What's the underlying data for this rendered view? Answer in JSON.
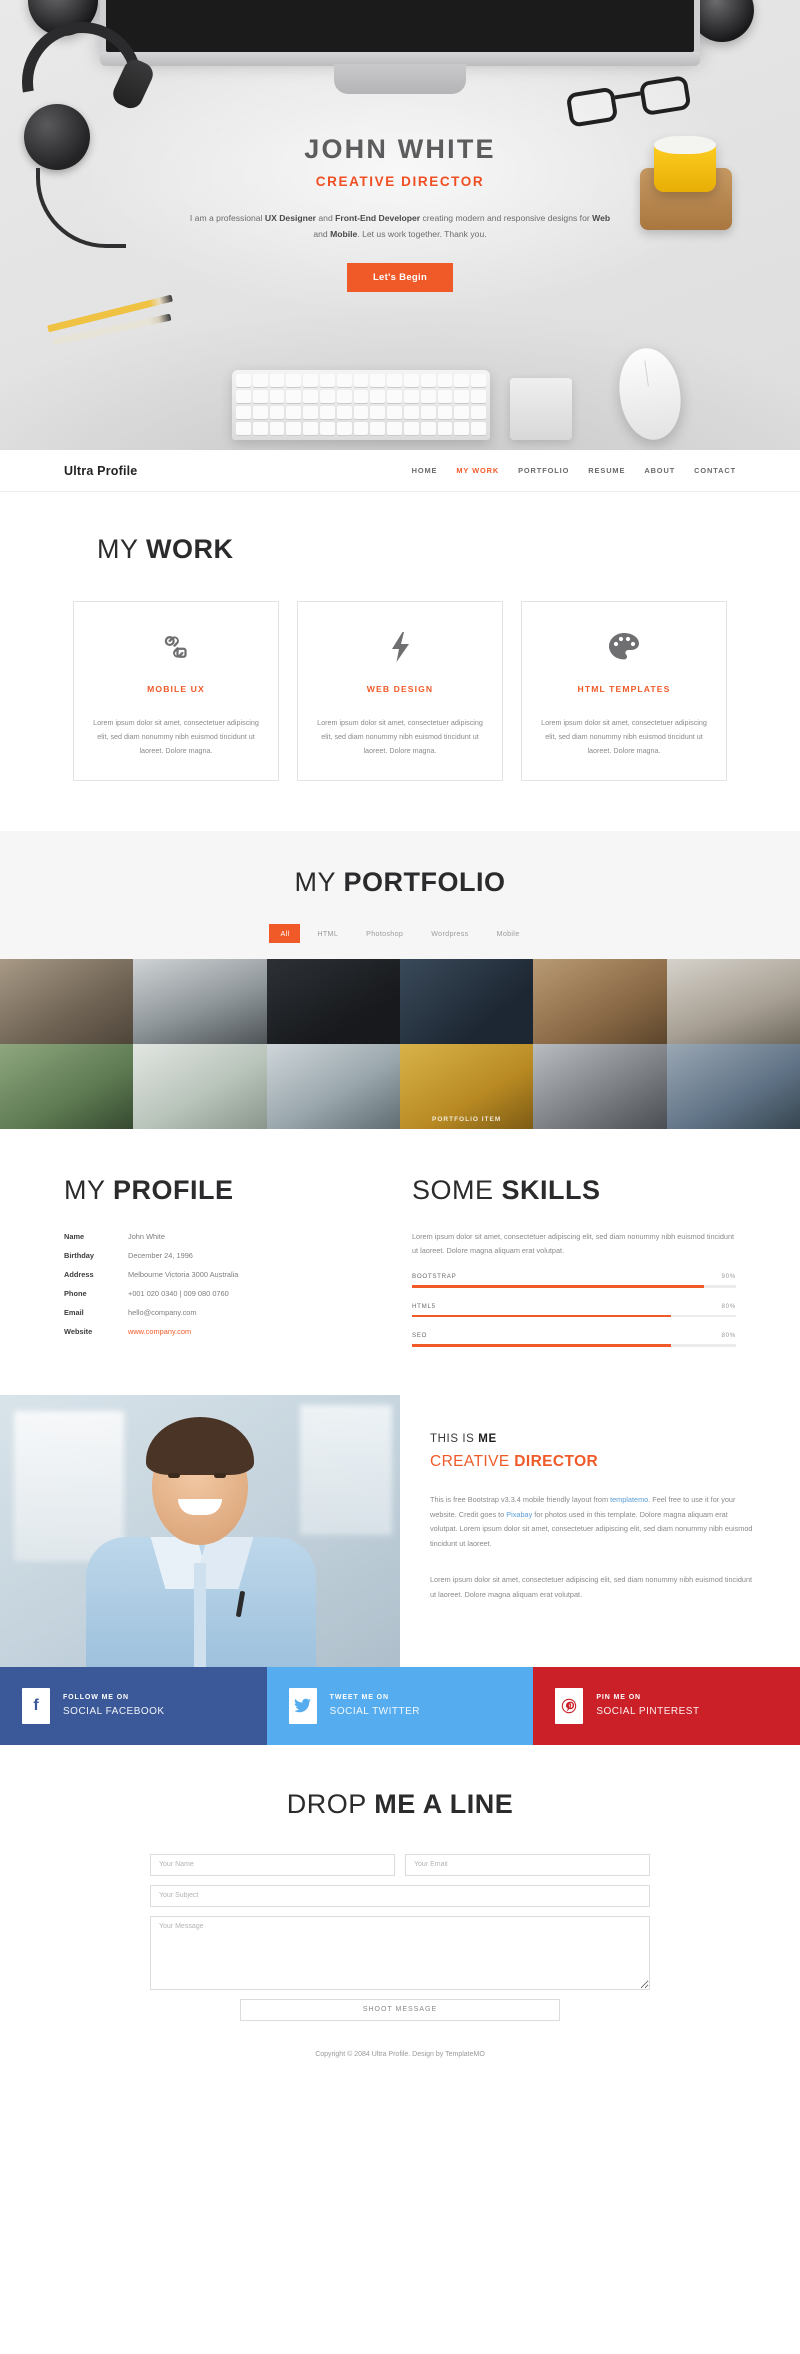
{
  "hero": {
    "name": "JOHN WHITE",
    "role": "CREATIVE DIRECTOR",
    "desc_1": "I am a professional ",
    "desc_b1": "UX Designer",
    "desc_2": " and ",
    "desc_b2": "Front-End Developer",
    "desc_3": " creating modern and responsive designs for ",
    "desc_b3": "Web",
    "desc_4": " and ",
    "desc_b4": "Mobile",
    "desc_5": ". Let us work together. Thank you.",
    "cta": "Let's Begin"
  },
  "nav": {
    "brand": "Ultra Profile",
    "items": [
      {
        "label": "HOME",
        "active": false
      },
      {
        "label": "MY WORK",
        "active": true
      },
      {
        "label": "PORTFOLIO",
        "active": false
      },
      {
        "label": "RESUME",
        "active": false
      },
      {
        "label": "ABOUT",
        "active": false
      },
      {
        "label": "CONTACT",
        "active": false
      }
    ]
  },
  "work": {
    "title_light": "MY ",
    "title_bold": "WORK",
    "cards": [
      {
        "icon": "chain-link-icon",
        "title": "MOBILE UX",
        "text": "Lorem ipsum dolor sit amet, consectetuer adipiscing elit, sed diam nonummy nibh euismod tincidunt ut laoreet. Dolore magna."
      },
      {
        "icon": "lightning-bolt-icon",
        "title": "WEB DESIGN",
        "text": "Lorem ipsum dolor sit amet, consectetuer adipiscing elit, sed diam nonummy nibh euismod tincidunt ut laoreet. Dolore magna."
      },
      {
        "icon": "palette-icon",
        "title": "HTML TEMPLATES",
        "text": "Lorem ipsum dolor sit amet, consectetuer adipiscing elit, sed diam nonummy nibh euismod tincidunt ut laoreet. Dolore magna."
      }
    ]
  },
  "portfolio": {
    "title_light": "MY ",
    "title_bold": "PORTFOLIO",
    "filters": [
      {
        "label": "All",
        "active": true
      },
      {
        "label": "HTML",
        "active": false
      },
      {
        "label": "Photoshop",
        "active": false
      },
      {
        "label": "Wordpress",
        "active": false
      },
      {
        "label": "Mobile",
        "active": false
      }
    ],
    "tiles": [
      {
        "caption": ""
      },
      {
        "caption": ""
      },
      {
        "caption": ""
      },
      {
        "caption": ""
      },
      {
        "caption": ""
      },
      {
        "caption": ""
      },
      {
        "caption": ""
      },
      {
        "caption": ""
      },
      {
        "caption": ""
      },
      {
        "caption": "PORTFOLIO ITEM"
      },
      {
        "caption": ""
      },
      {
        "caption": ""
      }
    ]
  },
  "profile": {
    "title_light": "MY ",
    "title_bold": "PROFILE",
    "rows": [
      {
        "key": "Name",
        "value": "John White",
        "link": false
      },
      {
        "key": "Birthday",
        "value": "December 24, 1996",
        "link": false
      },
      {
        "key": "Address",
        "value": "Melbourne Victoria 3000 Australia",
        "link": false
      },
      {
        "key": "Phone",
        "value": "+001 020 0340 | 009 080 0760",
        "link": false
      },
      {
        "key": "Email",
        "value": "hello@company.com",
        "link": false
      },
      {
        "key": "Website",
        "value": "www.company.com",
        "link": true
      }
    ]
  },
  "skills": {
    "title_light": "SOME ",
    "title_bold": "SKILLS",
    "intro": "Lorem ipsum dolor sit amet, consectetuer adipiscing elit, sed diam nonummy nibh euismod tincidunt ut laoreet. Dolore magna aliquam erat volutpat.",
    "items": [
      {
        "label": "BOOTSTRAP",
        "pct": "90%",
        "value": 90
      },
      {
        "label": "HTML5",
        "pct": "80%",
        "value": 80
      },
      {
        "label": "SEO",
        "pct": "80%",
        "value": 80
      }
    ]
  },
  "about": {
    "kicker_light": "THIS IS ",
    "kicker_bold": "ME",
    "role_light": "CREATIVE ",
    "role_bold": "DIRECTOR",
    "p1_a": "This is free Bootstrap v3.3.4 mobile friendly layout from ",
    "p1_link1": "templatemo",
    "p1_b": ". Feel free to use it for your website. Credit goes to ",
    "p1_link2": "Pixabay",
    "p1_c": " for photos used in this template. Dolore magna aliquam erat volutpat. Lorem ipsum dolor sit amet, consectetuer adipiscing elit, sed diam nonummy nibh euismod tincidunt ut laoreet.",
    "p2": "Lorem ipsum dolor sit amet, consectetuer adipiscing elit, sed diam nonummy nibh euismod tincidunt ut laoreet. Dolore magna aliquam erat volutpat."
  },
  "social": [
    {
      "icon": "facebook-icon",
      "top": "FOLLOW ME ON",
      "bottom": "SOCIAL FACEBOOK",
      "bg": "#3b5998",
      "glyph": "f",
      "glyph_color": "#3b5998"
    },
    {
      "icon": "twitter-icon",
      "top": "TWEET ME ON",
      "bottom": "SOCIAL TWITTER",
      "bg": "#55acee",
      "glyph": "ᵛ",
      "glyph_color": "#55acee"
    },
    {
      "icon": "pinterest-icon",
      "top": "PIN ME ON",
      "bottom": "SOCIAL PINTEREST",
      "bg": "#cb2027",
      "glyph": "ⓟ",
      "glyph_color": "#cb2027"
    }
  ],
  "contact": {
    "title_light": "DROP ",
    "title_bold": "ME A LINE",
    "name_placeholder": "Your Name",
    "email_placeholder": "Your Email",
    "subject_placeholder": "Your Subject",
    "message_placeholder": "Your Message",
    "submit_label": "SHOOT MESSAGE"
  },
  "footer": {
    "copyright": "Copyright © 2084 Ultra Profile. Design by TemplateMO"
  },
  "colors": {
    "accent": "#f05a28",
    "dark": "#2b2b2d",
    "muted": "#8a8a8c",
    "link": "#5b9bd5"
  }
}
